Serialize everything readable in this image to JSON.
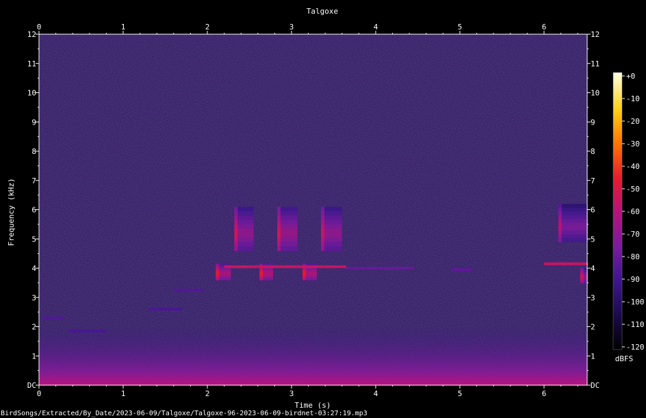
{
  "chart_data": {
    "type": "heatmap",
    "title": "Talgoxe",
    "xlabel": "Time (s)",
    "ylabel": "Frequency (kHz)",
    "xlim": [
      0,
      6.52
    ],
    "ylim": [
      0,
      12
    ],
    "x_ticks": [
      "0",
      "1",
      "2",
      "3",
      "4",
      "5",
      "6"
    ],
    "y_ticks": [
      "DC",
      "1",
      "2",
      "3",
      "4",
      "5",
      "6",
      "7",
      "8",
      "9",
      "10",
      "11",
      "12"
    ],
    "colorbar": {
      "label": "dBFS",
      "ticks": [
        "+0",
        "-10",
        "-20",
        "-30",
        "-40",
        "-50",
        "-60",
        "-70",
        "-80",
        "-90",
        "-100",
        "-110",
        "-120"
      ],
      "range": [
        -120,
        0
      ],
      "colormap": [
        "#000000",
        "#1a0a4a",
        "#3d1690",
        "#7a1aa0",
        "#b8127a",
        "#e61c2c",
        "#ff7a00",
        "#ffd21a",
        "#ffffe6"
      ]
    },
    "background_color": "#1e1150",
    "noise_floor_dbfs": -95,
    "calls": [
      {
        "t_start": 2.32,
        "t_end": 2.55,
        "f_low": 4.6,
        "f_high": 6.1,
        "peak_dbfs": -52
      },
      {
        "t_start": 2.83,
        "t_end": 3.07,
        "f_low": 4.6,
        "f_high": 6.1,
        "peak_dbfs": -50
      },
      {
        "t_start": 3.35,
        "t_end": 3.6,
        "f_low": 4.6,
        "f_high": 6.1,
        "peak_dbfs": -52
      },
      {
        "t_start": 6.17,
        "t_end": 6.52,
        "f_low": 4.9,
        "f_high": 6.2,
        "peak_dbfs": -58
      },
      {
        "t_start": 2.1,
        "t_end": 2.28,
        "f_low": 3.6,
        "f_high": 4.15,
        "peak_dbfs": -45
      },
      {
        "t_start": 2.62,
        "t_end": 2.78,
        "f_low": 3.6,
        "f_high": 4.15,
        "peak_dbfs": -43
      },
      {
        "t_start": 3.13,
        "t_end": 3.3,
        "f_low": 3.6,
        "f_high": 4.15,
        "peak_dbfs": -44
      },
      {
        "t_start": 6.43,
        "t_end": 6.52,
        "f_low": 3.5,
        "f_high": 4.0,
        "peak_dbfs": -50
      }
    ],
    "tones": [
      {
        "t_start": 2.2,
        "t_end": 3.65,
        "freq": 4.05,
        "peak_dbfs": -55
      },
      {
        "t_start": 3.65,
        "t_end": 4.45,
        "freq": 4.0,
        "peak_dbfs": -80
      },
      {
        "t_start": 4.9,
        "t_end": 5.15,
        "freq": 3.95,
        "peak_dbfs": -82
      },
      {
        "t_start": 6.0,
        "t_end": 6.52,
        "freq": 4.15,
        "peak_dbfs": -55
      },
      {
        "t_start": 1.6,
        "t_end": 1.95,
        "freq": 3.25,
        "peak_dbfs": -85
      },
      {
        "t_start": 0.05,
        "t_end": 0.3,
        "freq": 2.3,
        "peak_dbfs": -85
      },
      {
        "t_start": 0.35,
        "t_end": 0.8,
        "freq": 1.85,
        "peak_dbfs": -87
      },
      {
        "t_start": 1.3,
        "t_end": 1.7,
        "freq": 2.6,
        "peak_dbfs": -87
      }
    ]
  },
  "footer": {
    "filename": "BirdSongs/Extracted/By_Date/2023-06-09/Talgoxe/Talgoxe-96-2023-06-09-birdnet-03:27:19.mp3"
  }
}
